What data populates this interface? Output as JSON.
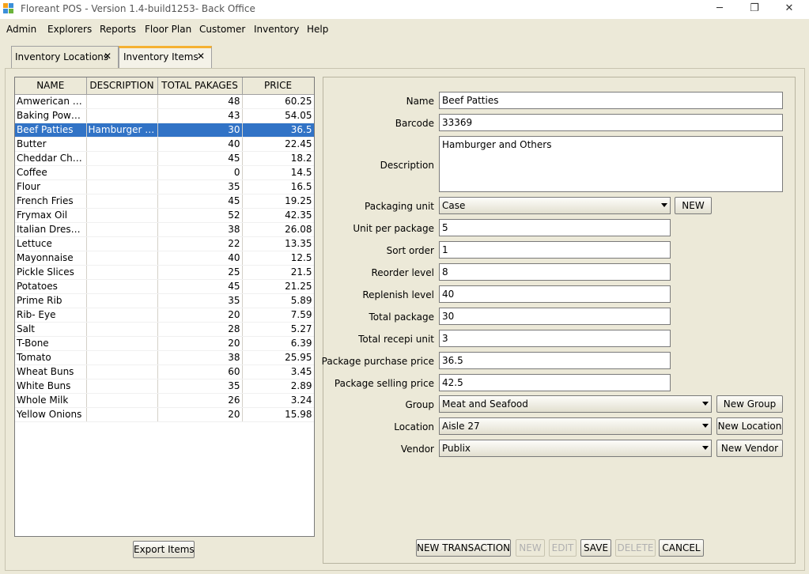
{
  "window": {
    "title": "Floreant POS - Version 1.4-build1253- Back Office",
    "minimize": "─",
    "maximize": "❐",
    "close": "✕"
  },
  "menu": [
    "Admin",
    "Explorers",
    "Reports",
    "Floor Plan",
    "Customer",
    "Inventory",
    "Help"
  ],
  "tabs": [
    {
      "label": "Inventory Locations",
      "close": "✕"
    },
    {
      "label": "Inventory Items",
      "close": "✕"
    }
  ],
  "table": {
    "columns": [
      "NAME",
      "DESCRIPTION",
      "TOTAL PAKAGES",
      "PRICE"
    ],
    "rows": [
      [
        "Amwerican Ch...",
        "",
        "48",
        "60.25"
      ],
      [
        "Baking Powder",
        "",
        "43",
        "54.05"
      ],
      [
        "Beef Patties",
        "Hamburger an...",
        "30",
        "36.5"
      ],
      [
        "Butter",
        "",
        "40",
        "22.45"
      ],
      [
        "Cheddar Cheese",
        "",
        "45",
        "18.2"
      ],
      [
        "Coffee",
        "",
        "0",
        "14.5"
      ],
      [
        "Flour",
        "",
        "35",
        "16.5"
      ],
      [
        "French Fries",
        "",
        "45",
        "19.25"
      ],
      [
        "Frymax Oil",
        "",
        "52",
        "42.35"
      ],
      [
        "Italian Dressing",
        "",
        "38",
        "26.08"
      ],
      [
        "Lettuce",
        "",
        "22",
        "13.35"
      ],
      [
        "Mayonnaise",
        "",
        "40",
        "12.5"
      ],
      [
        "Pickle Slices",
        "",
        "25",
        "21.5"
      ],
      [
        "Potatoes",
        "",
        "45",
        "21.25"
      ],
      [
        "Prime Rib",
        "",
        "35",
        "5.89"
      ],
      [
        "Rib- Eye",
        "",
        "20",
        "7.59"
      ],
      [
        "Salt",
        "",
        "28",
        "5.27"
      ],
      [
        "T-Bone",
        "",
        "20",
        "6.39"
      ],
      [
        "Tomato",
        "",
        "38",
        "25.95"
      ],
      [
        "Wheat Buns",
        "",
        "60",
        "3.45"
      ],
      [
        "White Buns",
        "",
        "35",
        "2.89"
      ],
      [
        "Whole Milk",
        "",
        "26",
        "3.24"
      ],
      [
        "Yellow Onions",
        "",
        "20",
        "15.98"
      ]
    ],
    "selected_index": 2
  },
  "export_button": "Export Items",
  "form": {
    "name_label": "Name",
    "name_value": "Beef Patties",
    "barcode_label": "Barcode",
    "barcode_value": "33369",
    "description_label": "Description",
    "description_value": "Hamburger and Others",
    "packaging_label": "Packaging unit",
    "packaging_value": "Case",
    "packaging_new": "NEW",
    "unit_per_package_label": "Unit per package",
    "unit_per_package_value": "5",
    "sort_order_label": "Sort order",
    "sort_order_value": "1",
    "reorder_label": "Reorder level",
    "reorder_value": "8",
    "replenish_label": "Replenish level",
    "replenish_value": "40",
    "total_package_label": "Total package",
    "total_package_value": "30",
    "total_recepi_label": "Total recepi unit",
    "total_recepi_value": "3",
    "purchase_price_label": "Package purchase price",
    "purchase_price_value": "36.5",
    "selling_price_label": "Package selling price",
    "selling_price_value": "42.5",
    "group_label": "Group",
    "group_value": "Meat and Seafood",
    "group_new": "New Group",
    "location_label": "Location",
    "location_value": "Aisle 27",
    "location_new": "New Location",
    "vendor_label": "Vendor",
    "vendor_value": "Publix",
    "vendor_new": "New Vendor"
  },
  "actions": {
    "new_transaction": "NEW TRANSACTION",
    "new": "NEW",
    "edit": "EDIT",
    "save": "SAVE",
    "delete": "DELETE",
    "cancel": "CANCEL"
  },
  "colors": {
    "selection": "#3173c6",
    "active_tab_accent": "#f5b133",
    "background": "#ece9d8"
  }
}
